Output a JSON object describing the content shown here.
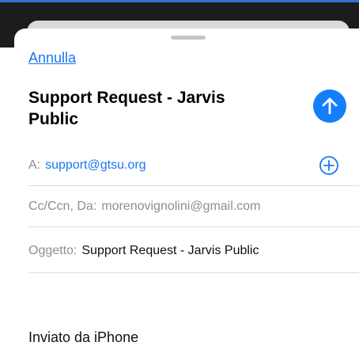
{
  "header": {
    "cancel_label": "Annulla",
    "title": "Support Request - Jarvis Public"
  },
  "fields": {
    "to_label": "A:",
    "to_value": "support@gtsu.org",
    "cc_label": "Cc/Ccn, Da:",
    "cc_value": "morenovignolini@gmail.com",
    "subject_label": "Oggetto:",
    "subject_value": "Support Request - Jarvis Public"
  },
  "body": {
    "signature": "Inviato da iPhone"
  },
  "icons": {
    "send": "arrow-up-icon",
    "add": "plus-circle-icon"
  },
  "colors": {
    "accent": "#157efb",
    "link": "#1877f2",
    "label": "#8e8e93"
  }
}
